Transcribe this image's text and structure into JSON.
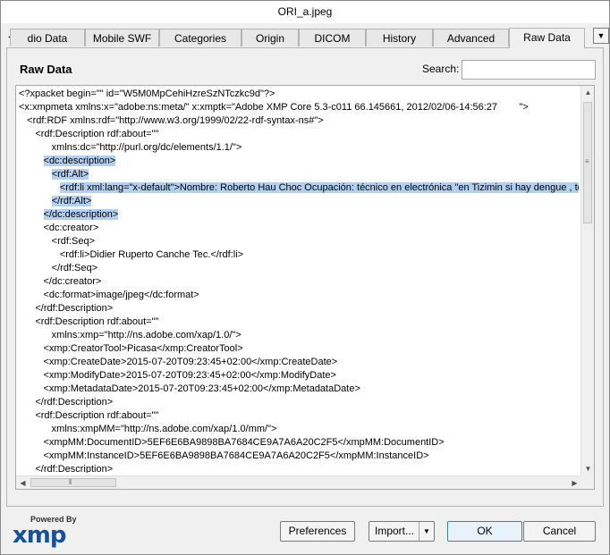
{
  "window": {
    "title": "ORI_a.jpeg"
  },
  "tabs": [
    {
      "label": "dio Data",
      "active": false
    },
    {
      "label": "Mobile SWF",
      "active": false
    },
    {
      "label": "Categories",
      "active": false
    },
    {
      "label": "Origin",
      "active": false
    },
    {
      "label": "DICOM",
      "active": false
    },
    {
      "label": "History",
      "active": false
    },
    {
      "label": "Advanced",
      "active": false
    },
    {
      "label": "Raw Data",
      "active": true
    }
  ],
  "panel": {
    "title": "Raw Data",
    "search_label": "Search:",
    "search_value": ""
  },
  "raw_lines": [
    "<?xpacket begin=\"\" id=\"W5M0MpCehiHzreSzNTczkc9d\"?>",
    "<x:xmpmeta xmlns:x=\"adobe:ns:meta/\" x:xmptk=\"Adobe XMP Core 5.3-c011 66.145661, 2012/02/06-14:56:27        \">",
    "   <rdf:RDF xmlns:rdf=\"http://www.w3.org/1999/02/22-rdf-syntax-ns#\">",
    "      <rdf:Description rdf:about=\"\"",
    "            xmlns:dc=\"http://purl.org/dc/elements/1.1/\">",
    "         <dc:description>",
    "            <rdf:Alt>",
    "               <rdf:li xml:lang=\"x-default\">Nombre: Roberto Hau Choc Ocupación: técnico en electrónica \"en Tizimin si hay dengue , toc",
    "            </rdf:Alt>",
    "         </dc:description>",
    "         <dc:creator>",
    "            <rdf:Seq>",
    "               <rdf:li>Didier Ruperto Canche Tec.</rdf:li>",
    "            </rdf:Seq>",
    "         </dc:creator>",
    "         <dc:format>image/jpeg</dc:format>",
    "      </rdf:Description>",
    "      <rdf:Description rdf:about=\"\"",
    "            xmlns:xmp=\"http://ns.adobe.com/xap/1.0/\">",
    "         <xmp:CreatorTool>Picasa</xmp:CreatorTool>",
    "         <xmp:CreateDate>2015-07-20T09:23:45+02:00</xmp:CreateDate>",
    "         <xmp:ModifyDate>2015-07-20T09:23:45+02:00</xmp:ModifyDate>",
    "         <xmp:MetadataDate>2015-07-20T09:23:45+02:00</xmp:MetadataDate>",
    "      </rdf:Description>",
    "      <rdf:Description rdf:about=\"\"",
    "            xmlns:xmpMM=\"http://ns.adobe.com/xap/1.0/mm/\">",
    "         <xmpMM:DocumentID>5EF6E6BA9898BA7684CE9A7A6A20C2F5</xmpMM:DocumentID>",
    "         <xmpMM:InstanceID>5EF6E6BA9898BA7684CE9A7A6A20C2F5</xmpMM:InstanceID>",
    "      </rdf:Description>"
  ],
  "highlighted_lines": [
    5,
    6,
    7,
    8,
    9
  ],
  "logo": {
    "powered_by": "Powered By",
    "brand": "xmp"
  },
  "buttons": {
    "preferences": "Preferences",
    "import": "Import...",
    "ok": "OK",
    "cancel": "Cancel"
  },
  "colors": {
    "selection": "#b4d0f0",
    "logo": "#1a4f9c"
  }
}
